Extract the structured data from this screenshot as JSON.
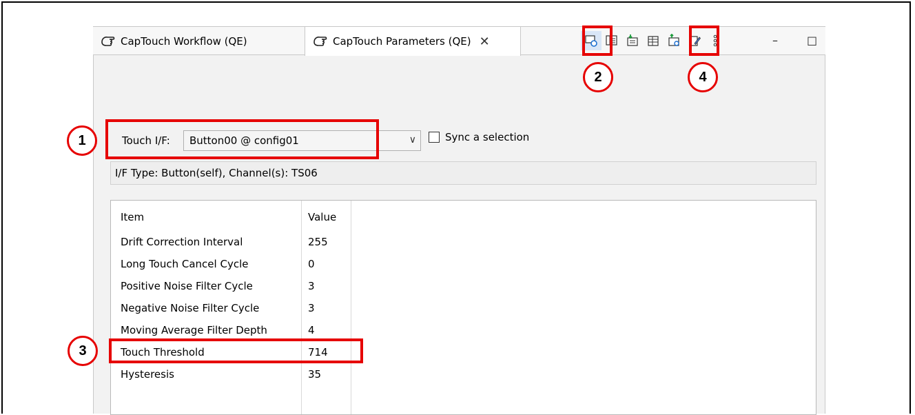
{
  "tabs": [
    {
      "label": "CapTouch Workflow (QE)"
    },
    {
      "label": "CapTouch Parameters (QE)",
      "close": "✕"
    }
  ],
  "toolbar": {
    "icons": [
      "monitor-refresh-icon",
      "panel-icon",
      "download-icon",
      "table-icon",
      "upload-icon",
      "edit-icon",
      "more-icon"
    ],
    "minimize": "–",
    "maximize": "□"
  },
  "form": {
    "touch_if_label": "Touch I/F:",
    "touch_if_value": "Button00 @ config01",
    "dropdown_arrow": "∨",
    "sync_label": "Sync a selection",
    "if_type_text": "I/F Type: Button(self), Channel(s): TS06"
  },
  "table": {
    "headers": [
      "Item",
      "Value"
    ],
    "rows": [
      {
        "item": "Drift Correction Interval",
        "value": "255"
      },
      {
        "item": "Long Touch Cancel Cycle",
        "value": "0"
      },
      {
        "item": "Positive Noise Filter Cycle",
        "value": "3"
      },
      {
        "item": "Negative Noise Filter Cycle",
        "value": "3"
      },
      {
        "item": "Moving Average Filter Depth",
        "value": "4"
      },
      {
        "item": "Touch Threshold",
        "value": "714"
      },
      {
        "item": "Hysteresis",
        "value": "35"
      }
    ]
  },
  "callouts": [
    "1",
    "2",
    "3",
    "4"
  ],
  "colors": {
    "callout": "#e60000",
    "pressed": "#d9e6f7"
  }
}
